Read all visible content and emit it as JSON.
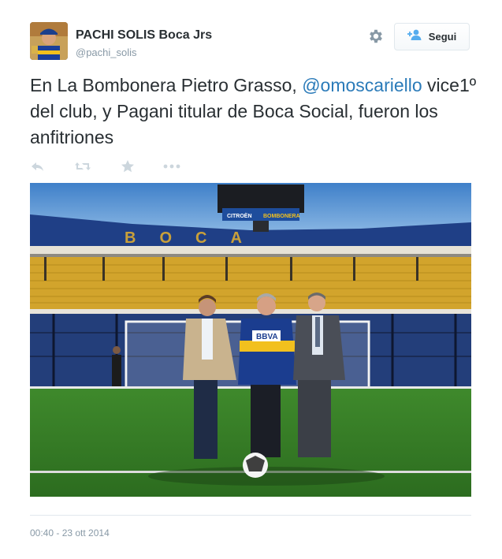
{
  "tweet": {
    "author_name": "PACHI SOLIS Boca Jrs",
    "author_handle": "@pachi_solis",
    "text_before": "En La Bombonera Pietro Grasso, ",
    "mention": "@omoscariello",
    "text_after": " vice1º del club, y Pagani titular de Boca Social, fueron los anfitriones",
    "timestamp": "00:40 - 23 ott 2014"
  },
  "header": {
    "follow_label": "Segui",
    "follow_icon": "add-user-icon",
    "settings_icon": "gear-icon"
  },
  "actions": [
    {
      "name": "reply-icon"
    },
    {
      "name": "retweet-icon"
    },
    {
      "name": "favorite-icon"
    },
    {
      "name": "more-icon"
    }
  ],
  "photo": {
    "scoreboard_sponsor_1": "CITROËN",
    "scoreboard_sponsor_2": "BOMBONERA",
    "stand_lettering": "BOCA",
    "jersey_sponsor": "BBVA"
  },
  "colors": {
    "link": "#2b7bb9",
    "text": "#292f33",
    "muted": "#8899a6",
    "border": "#e1e8ed"
  }
}
